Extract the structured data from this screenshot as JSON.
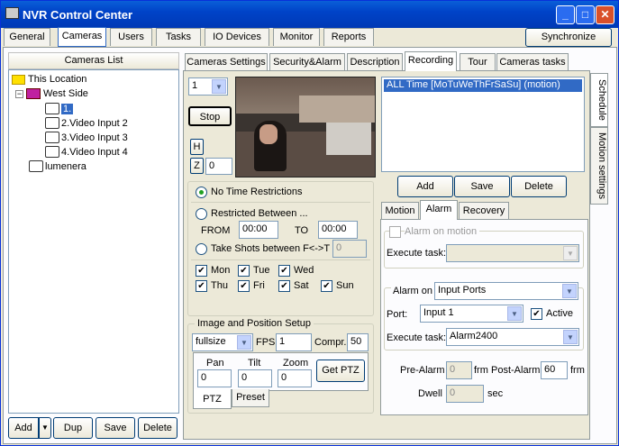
{
  "window": {
    "title": "NVR Control Center"
  },
  "main_tabs": [
    "General",
    "Cameras",
    "Users",
    "Tasks",
    "IO Devices",
    "Monitor",
    "Reports"
  ],
  "synchronize_label": "Synchronize",
  "cameras_list": {
    "header": "Cameras List",
    "items": [
      "This Location",
      "West Side",
      "1.",
      "2.Video Input 2",
      "3.Video Input 3",
      "4.Video Input 4",
      "lumenera"
    ],
    "buttons": [
      "Add",
      "Dup",
      "Save",
      "Delete"
    ]
  },
  "sub_tabs": [
    "Cameras Settings",
    "Security&Alarm",
    "Description",
    "Recording",
    "Tour",
    "Cameras tasks"
  ],
  "side_tabs": [
    "Schedule",
    "Motion settings"
  ],
  "recording": {
    "channel_value": "1",
    "stop_label": "Stop",
    "h_label": "H",
    "z_label": "Z",
    "z_value": "0",
    "schedule_item": "ALL Time [MoTuWeThFrSaSu] (motion)",
    "schedule_buttons": [
      "Add",
      "Save",
      "Delete"
    ],
    "no_restrictions": "No Time Restrictions",
    "restricted_between": "Restricted Between ...",
    "from_label": "FROM",
    "from_value": "00:00",
    "to_label": "TO",
    "to_value": "00:00",
    "take_shots": "Take Shots between F<->T",
    "take_shots_value": "0",
    "days": [
      "Mon",
      "Tue",
      "Wed",
      "Thu",
      "Fri",
      "Sat",
      "Sun"
    ],
    "image_setup_title": "Image and Position Setup",
    "size_value": "fullsize",
    "fps_label": "FPS",
    "fps_value": "1",
    "compr_label": "Compr.",
    "compr_value": "50",
    "pan_label": "Pan",
    "pan_value": "0",
    "tilt_label": "Tilt",
    "tilt_value": "0",
    "zoom_label": "Zoom",
    "zoom_value": "0",
    "get_ptz_label": "Get PTZ",
    "ptz_tabs": [
      "PTZ",
      "Preset"
    ]
  },
  "alarm": {
    "tabs": [
      "Motion",
      "Alarm",
      "Recovery"
    ],
    "alarm_on_motion": "Alarm on motion",
    "execute_task_label": "Execute task:",
    "execute_task_value_1": "",
    "alarm_on_label": "Alarm on",
    "alarm_on_value": "Input Ports",
    "port_label": "Port:",
    "port_value": "Input 1",
    "active_label": "Active",
    "execute_task_value_2": "Alarm2400",
    "pre_alarm_label": "Pre-Alarm",
    "pre_alarm_value": "0",
    "frm_label": "frm",
    "post_alarm_label": "Post-Alarm",
    "post_alarm_value": "60",
    "frm_label_2": "frm",
    "dwell_label": "Dwell",
    "dwell_value": "0",
    "sec_label": "sec"
  }
}
